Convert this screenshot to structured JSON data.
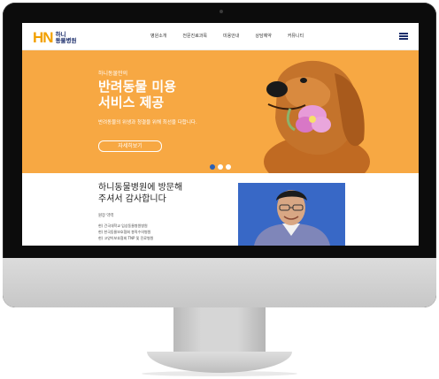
{
  "nav": {
    "logo_mark": "HN",
    "logo_line1": "하니",
    "logo_line2": "동물병원",
    "items": [
      "병원소개",
      "전문진료과목",
      "미용안내",
      "상담예약",
      "커뮤니티"
    ]
  },
  "hero": {
    "kicker": "하니동물만의",
    "title_line1": "반려동물 미용",
    "title_line2": "서비스 제공",
    "subtitle": "반려동물의 위생과 청결을 위해 최선을 다합니다.",
    "button": "자세히보기",
    "slides_total": 3,
    "active_slide": 1
  },
  "content": {
    "greeting_line1": "하니동물병원에 방문해",
    "greeting_line2": "주셔서 감사합니다",
    "role": "원장 약력",
    "career": [
      "현) 건국대학교 임상동물병원병원",
      "현) 한국동물보호협회 봉직수의병원",
      "현) 고양이보호협회 TNP 및 진료병원"
    ]
  },
  "colors": {
    "hero_bg": "#f7a843",
    "brand_navy": "#1b2d6b",
    "active_dot": "#2d60b3"
  }
}
